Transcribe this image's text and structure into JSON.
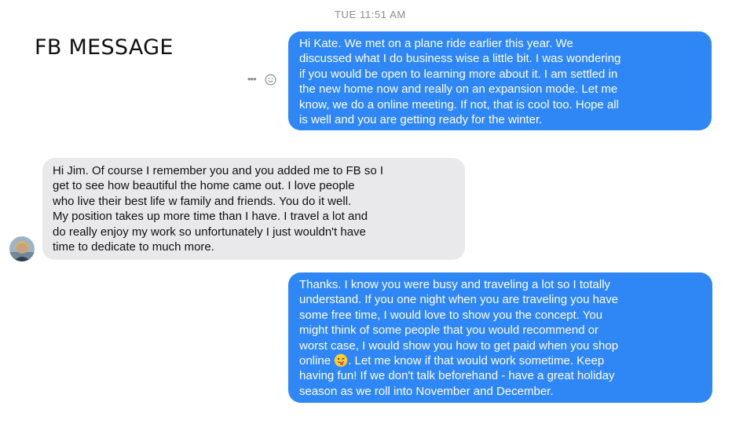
{
  "slide": {
    "title": "FB MESSAGE"
  },
  "thread": {
    "timestamp": "TUE 11:51 AM"
  },
  "messages": [
    {
      "from": "me",
      "text": "Hi Kate.  We met on a plane ride earlier this year.  We\ndiscussed what I do business wise a little bit.  I was wondering\nif you would be open to learning more about it.  I am settled in\nthe new home now and really on an expansion mode. Let me\nknow, we do a online meeting. If not, that is cool too.  Hope all\nis well and you are getting ready for the winter."
    },
    {
      "from": "contact",
      "text": "Hi Jim.  Of course I remember you and you added me to FB so I\nget to see how beautiful the home came out.   I love people\nwho live their best life w family and friends.   You do it well.\nMy position takes up more time than I have.   I travel a lot and\ndo really enjoy my work so unfortunately I just wouldn't have\ntime to dedicate to much more."
    },
    {
      "from": "me",
      "text_before_emoji": "Thanks. I know you were busy and traveling a lot so I totally\nunderstand.  If you one night when you are traveling you have\nsome free time, I would love to show you the concept.     You\nmight think of some people that you would recommend or\nworst case, I would show you how to get paid when you shop\nonline ",
      "text_after_emoji": ".  Let me know if that would work sometime.  Keep\nhaving fun! If we don't talk beforehand - have a great holiday\nseason as we roll into November and December.",
      "emoji": "winking-tongue-emoji"
    }
  ],
  "icons": {
    "more": "more-options-icon",
    "react": "emoji-react-icon",
    "avatar": "contact-avatar"
  },
  "colors": {
    "outgoing_bubble": "#2f87f5",
    "incoming_bubble": "#e9e9eb",
    "timestamp": "#8a8a8e"
  }
}
